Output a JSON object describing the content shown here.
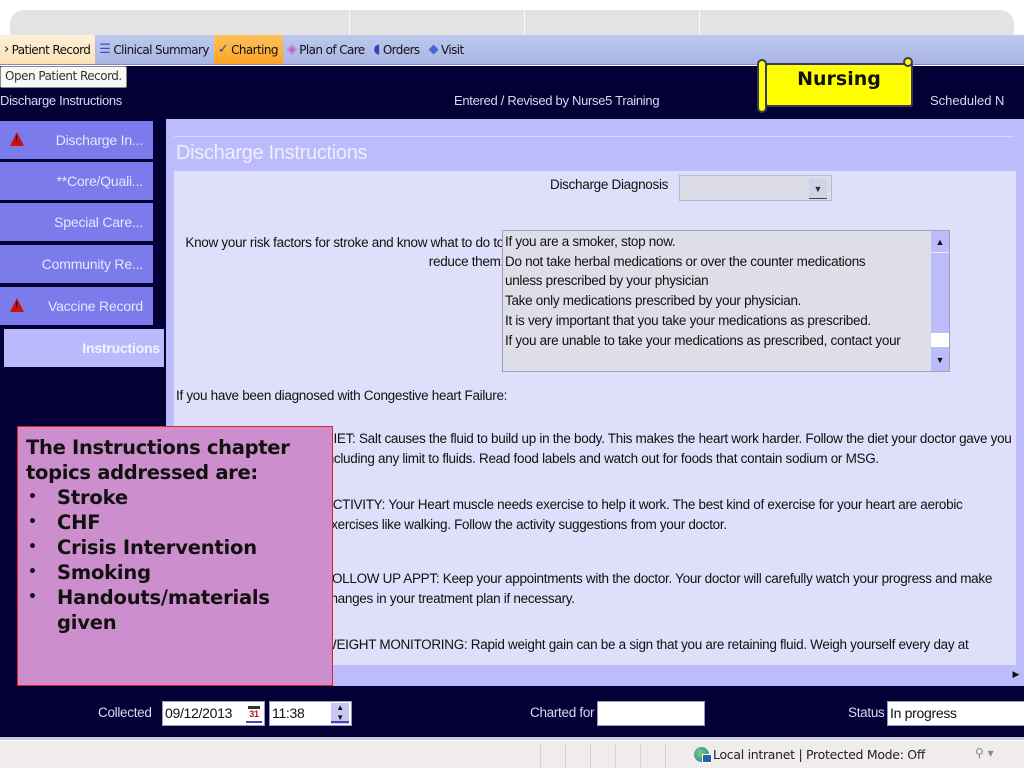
{
  "browser": {
    "status_zone": "Local intranet | Protected Mode: Off",
    "zoom_control": "⚲ ▾"
  },
  "tabs": [
    {
      "label": "Patient Record",
      "icon": "arrow-icon",
      "glyph": "›",
      "state": "hover"
    },
    {
      "label": "Clinical Summary",
      "icon": "clinical-summary-icon",
      "glyph": "☰",
      "state": "normal"
    },
    {
      "label": "Charting",
      "icon": "charting-icon",
      "glyph": "✓",
      "state": "active"
    },
    {
      "label": "Plan of Care",
      "icon": "plan-of-care-icon",
      "glyph": "◈",
      "state": "normal"
    },
    {
      "label": "Orders",
      "icon": "orders-icon",
      "glyph": "◖",
      "state": "normal"
    },
    {
      "label": "Visit",
      "icon": "visit-icon",
      "glyph": "◆",
      "state": "normal"
    }
  ],
  "tooltip": "Open Patient Record.",
  "header": {
    "form_name": "Discharge Instructions",
    "entered_by": "Entered / Revised by  Nurse5 Training",
    "scheduled": "Scheduled  N",
    "banner": "Nursing"
  },
  "sidebar": {
    "items": [
      {
        "label": "Discharge In...",
        "warning": true
      },
      {
        "label": "**Core/Quali...",
        "warning": false
      },
      {
        "label": "Special Care...",
        "warning": false
      },
      {
        "label": "Community Re...",
        "warning": false
      },
      {
        "label": "Vaccine Record",
        "warning": true
      },
      {
        "label": "Instructions",
        "warning": false,
        "selected": true
      }
    ]
  },
  "content": {
    "title": "Discharge Instructions",
    "discharge_diagnosis": {
      "label": "Discharge Diagnosis",
      "value": ""
    },
    "risk": {
      "label": "Know your risk factors for stroke and know what to do to reduce them:",
      "lines": [
        "If you are a smoker, stop now.",
        "Do not take herbal medications or over the counter medications",
        "unless prescribed by your physician",
        "Take only  medications prescribed by your physician.",
        "It is very important that you take your medications as prescribed.",
        "If you are unable to take your medications as prescribed, contact your"
      ]
    },
    "chf_intro": "If you have been diagnosed with Congestive heart Failure:",
    "chf_paragraphs": [
      "DIET: Salt causes the fluid to build up in the body. This makes the heart work harder. Follow the diet your doctor gave you including any limit to fluids. Read food labels and watch out for foods that contain sodium or MSG.",
      "ACTIVITY: Your Heart muscle needs exercise to help it work. The best kind of exercise for your heart are aerobic exercises like walking. Follow the activity suggestions from your doctor.",
      "FOLLOW UP APPT: Keep your appointments with the doctor. Your doctor will carefully watch your progress and make changes in your treatment plan if necessary.",
      "WEIGHT MONITORING: Rapid weight gain can be a sign that you are retaining fluid. Weigh yourself every day at"
    ]
  },
  "callout": {
    "heading": "The Instructions chapter topics addressed are:",
    "bullets": [
      "Stroke",
      "CHF",
      "Crisis Intervention",
      "Smoking",
      "Handouts/materials given"
    ]
  },
  "footer": {
    "collected_label": "Collected",
    "collected_date": "09/12/2013",
    "calendar_day": "31",
    "collected_time": "11:38",
    "charted_for_label": "Charted for",
    "charted_for_value": "",
    "status_label": "Status",
    "status_value": "In progress"
  }
}
